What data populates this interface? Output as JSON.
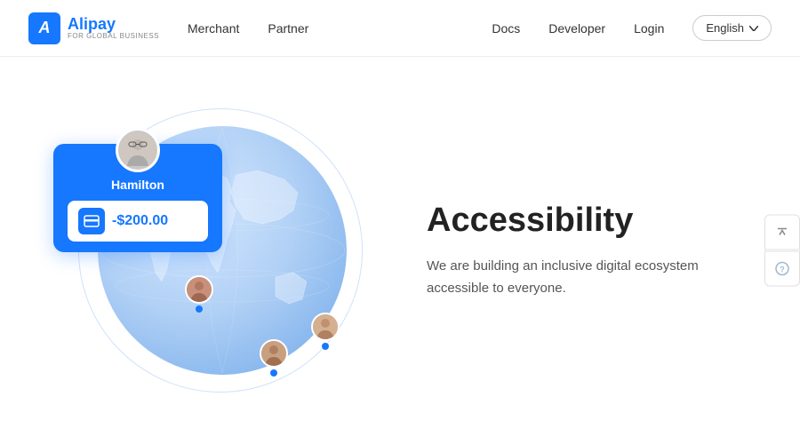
{
  "nav": {
    "logo_text": "Alipay",
    "logo_sub": "FOR GLOBAL BUSINESS",
    "merchant_label": "Merchant",
    "partner_label": "Partner",
    "docs_label": "Docs",
    "developer_label": "Developer",
    "login_label": "Login",
    "language_label": "English"
  },
  "hero": {
    "user_name": "Hamilton",
    "user_amount": "-$200.00",
    "section_title": "Accessibility",
    "section_desc": "We are building an inclusive digital ecosystem accessible to everyone.",
    "scroll_top_label": "▲",
    "help_label": "?"
  }
}
